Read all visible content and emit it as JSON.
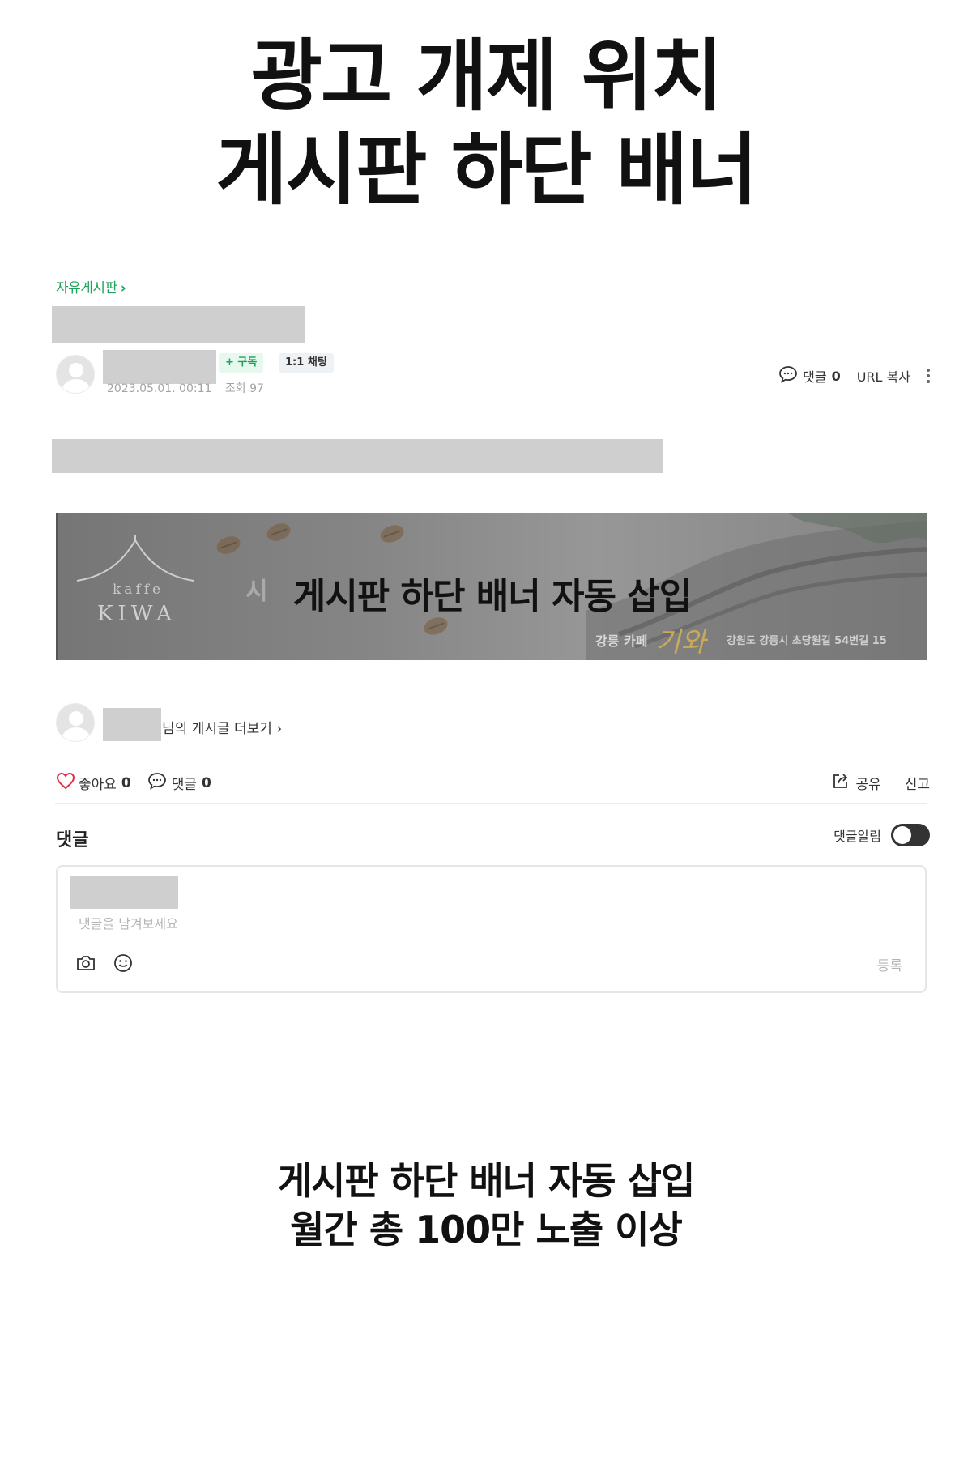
{
  "hero": {
    "line1": "광고 개제 위치",
    "line2": "게시판 하단 배너"
  },
  "board": {
    "breadcrumb": "자유게시판"
  },
  "post": {
    "subscribe_label": "+ 구독",
    "chat_label": "1:1 채팅",
    "date": "2023.05.01. 00:11",
    "views": "조회 97",
    "comment_label": "댓글",
    "comment_count": "0",
    "url_copy": "URL 복사"
  },
  "banner": {
    "overlay_text": "게시판 하단 배너 자동 삽입",
    "faint_text": "시",
    "logo_kaffe": "kaffe",
    "logo_kiwa": "KIWA",
    "cafe_label": "강릉 카페",
    "cafe_name": "기와",
    "address": "강원도 강릉시 초당원길 54번길 15"
  },
  "author_more": {
    "text": "님의 게시글 더보기 ›"
  },
  "reactions": {
    "like_label": "좋아요",
    "like_count": "0",
    "comment_label": "댓글",
    "comment_count": "0",
    "share_label": "공유",
    "report_label": "신고"
  },
  "comments": {
    "title": "댓글",
    "alarm_label": "댓글알림",
    "placeholder": "댓글을 남겨보세요",
    "submit_label": "등록"
  },
  "footer": {
    "line1": "게시판 하단 배너 자동 삽입",
    "line2": "월간 총 100만 노출 이상"
  },
  "colors": {
    "accent_green": "#1fa35a",
    "like_red": "#e0314b",
    "kiwa_gold": "#c9a95a"
  },
  "icons": [
    "chevron-right-icon",
    "comment-bubble-icon",
    "kebab-icon",
    "heart-icon",
    "share-icon",
    "camera-icon",
    "smile-icon"
  ]
}
